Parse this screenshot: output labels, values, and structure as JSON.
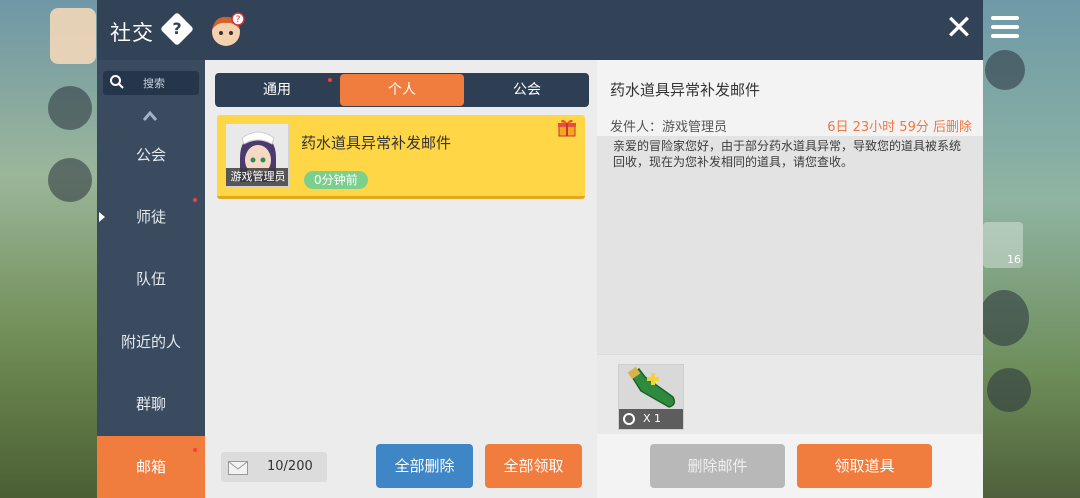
{
  "window": {
    "title": "社交",
    "close_symbol": "✕",
    "help_symbol": "?"
  },
  "sidebar": {
    "search_placeholder": "搜索",
    "items": [
      {
        "label": "公会",
        "active": false,
        "dot": false
      },
      {
        "label": "师徒",
        "active": false,
        "dot": true
      },
      {
        "label": "队伍",
        "active": false,
        "dot": false
      },
      {
        "label": "附近的人",
        "active": false,
        "dot": false
      },
      {
        "label": "群聊",
        "active": false,
        "dot": false
      },
      {
        "label": "邮箱",
        "active": true,
        "dot": true
      }
    ]
  },
  "tabs": [
    {
      "label": "通用",
      "active": false,
      "dot": true
    },
    {
      "label": "个人",
      "active": true,
      "dot": false
    },
    {
      "label": "公会",
      "active": false,
      "dot": false
    }
  ],
  "mail_list": [
    {
      "title": "药水道具异常补发邮件",
      "sender_tag": "游戏管理员",
      "time": "0分钟前",
      "has_gift": true
    }
  ],
  "mailbox": {
    "count": "10/200",
    "delete_all_label": "全部删除",
    "claim_all_label": "全部领取"
  },
  "detail": {
    "title": "药水道具异常补发邮件",
    "sender": "发件人：游戏管理员",
    "expiry": "6日 23小时 59分 后删除",
    "body": "亲爱的冒险家您好，由于部分药水道具异常，导致您的道具被系统回收，现在为您补发相同的道具，请您查收。",
    "attachment": {
      "quantity": "X 1",
      "icon": "potion-bottle-icon"
    },
    "delete_label": "删除邮件",
    "claim_label": "领取道具"
  },
  "background": {
    "item_count": "16"
  },
  "colors": {
    "accent": "#f07c3e",
    "header": "#324257",
    "sidebar": "#3a4b5f",
    "mail_item": "#ffd645",
    "badge_green": "#7ccf8d",
    "expiry": "#f2773f"
  }
}
